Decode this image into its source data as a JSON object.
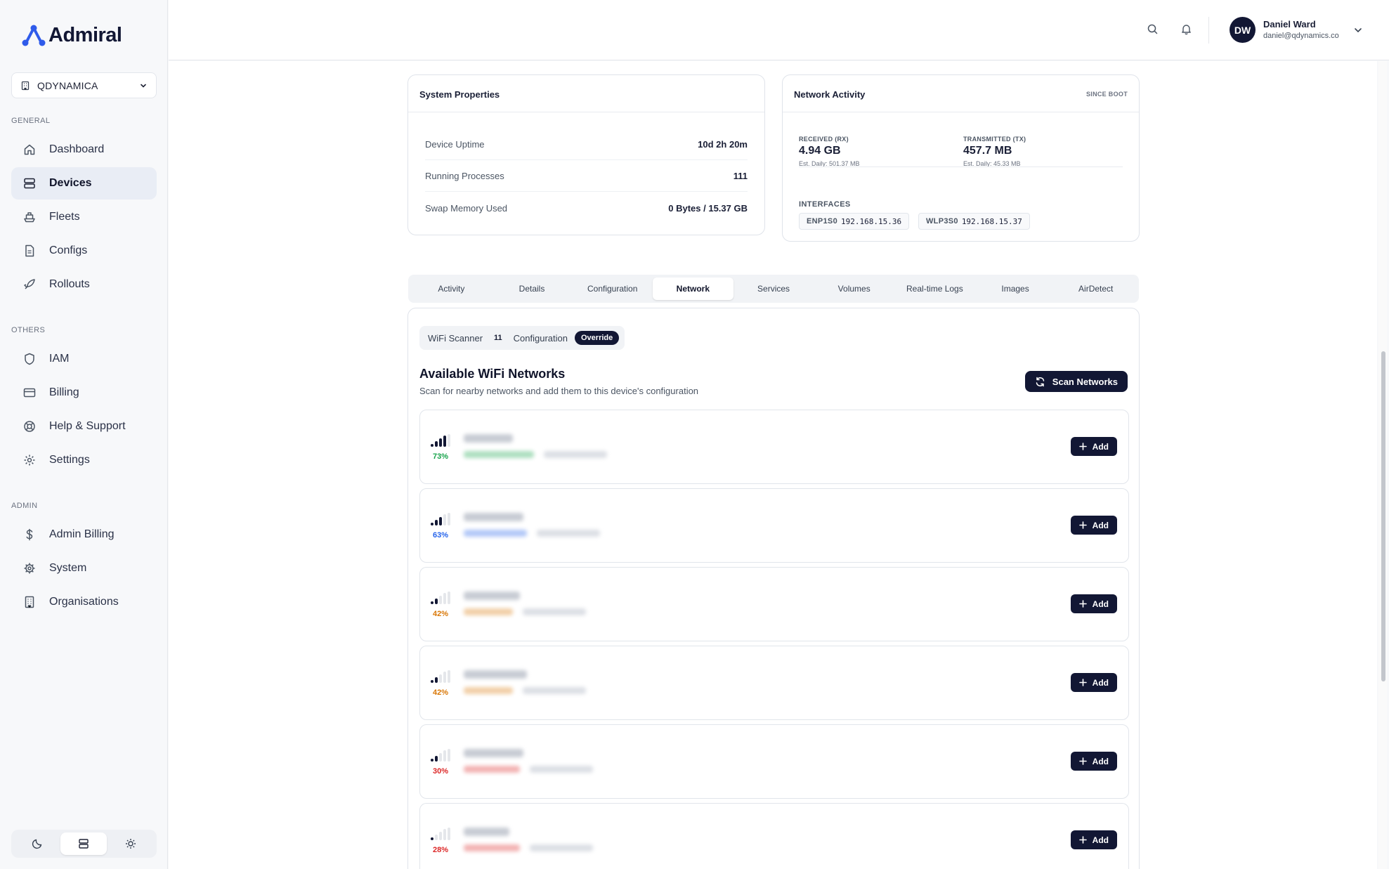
{
  "app": {
    "name": "Admiral"
  },
  "org": {
    "name": "QDYNAMICA"
  },
  "sidebar": {
    "sections": [
      {
        "label": "GENERAL",
        "items": [
          {
            "label": "Dashboard",
            "icon": "home-icon"
          },
          {
            "label": "Devices",
            "icon": "server-icon",
            "active": true
          },
          {
            "label": "Fleets",
            "icon": "ship-icon"
          },
          {
            "label": "Configs",
            "icon": "file-icon"
          },
          {
            "label": "Rollouts",
            "icon": "rocket-icon"
          }
        ]
      },
      {
        "label": "OTHERS",
        "items": [
          {
            "label": "IAM",
            "icon": "shield-icon"
          },
          {
            "label": "Billing",
            "icon": "credit-card-icon"
          },
          {
            "label": "Help & Support",
            "icon": "lifebuoy-icon"
          },
          {
            "label": "Settings",
            "icon": "gear-icon"
          }
        ]
      },
      {
        "label": "ADMIN",
        "items": [
          {
            "label": "Admin Billing",
            "icon": "dollar-icon"
          },
          {
            "label": "System",
            "icon": "cog-icon"
          },
          {
            "label": "Organisations",
            "icon": "building-icon"
          }
        ]
      }
    ]
  },
  "header": {
    "user": {
      "initials": "DW",
      "name": "Daniel Ward",
      "email": "daniel@qdynamics.co"
    }
  },
  "system_properties": {
    "title": "System Properties",
    "rows": [
      {
        "label": "Device Uptime",
        "value": "10d 2h 20m"
      },
      {
        "label": "Running Processes",
        "value": "111"
      },
      {
        "label": "Swap Memory Used",
        "value": "0 Bytes / 15.37 GB"
      }
    ]
  },
  "network_activity": {
    "title": "Network Activity",
    "since": "SINCE BOOT",
    "rx": {
      "label": "RECEIVED (RX)",
      "value": "4.94 GB",
      "daily": "Est. Daily: 501.37 MB"
    },
    "tx": {
      "label": "TRANSMITTED (TX)",
      "value": "457.7 MB",
      "daily": "Est. Daily: 45.33 MB"
    },
    "interfaces_label": "INTERFACES",
    "interfaces": [
      {
        "name": "ENP1S0",
        "ip": "192.168.15.36"
      },
      {
        "name": "WLP3S0",
        "ip": "192.168.15.37"
      }
    ]
  },
  "tabs": [
    "Activity",
    "Details",
    "Configuration",
    "Network",
    "Services",
    "Volumes",
    "Real-time Logs",
    "Images",
    "AirDetect"
  ],
  "active_tab": "Network",
  "subtabs": {
    "scanner": "WiFi Scanner",
    "count": "11",
    "configuration": "Configuration",
    "override": "Override"
  },
  "wifi": {
    "title": "Available WiFi Networks",
    "description": "Scan for nearby networks and add them to this device's configuration",
    "scan_label": "Scan Networks",
    "add_label": "Add",
    "networks": [
      {
        "signal": "73%",
        "level": 0.73,
        "color": "#16a34a"
      },
      {
        "signal": "63%",
        "level": 0.63,
        "color": "#2563eb"
      },
      {
        "signal": "42%",
        "level": 0.42,
        "color": "#d97706"
      },
      {
        "signal": "42%",
        "level": 0.42,
        "color": "#d97706"
      },
      {
        "signal": "30%",
        "level": 0.3,
        "color": "#dc2626"
      },
      {
        "signal": "28%",
        "level": 0.28,
        "color": "#dc2626"
      }
    ]
  }
}
